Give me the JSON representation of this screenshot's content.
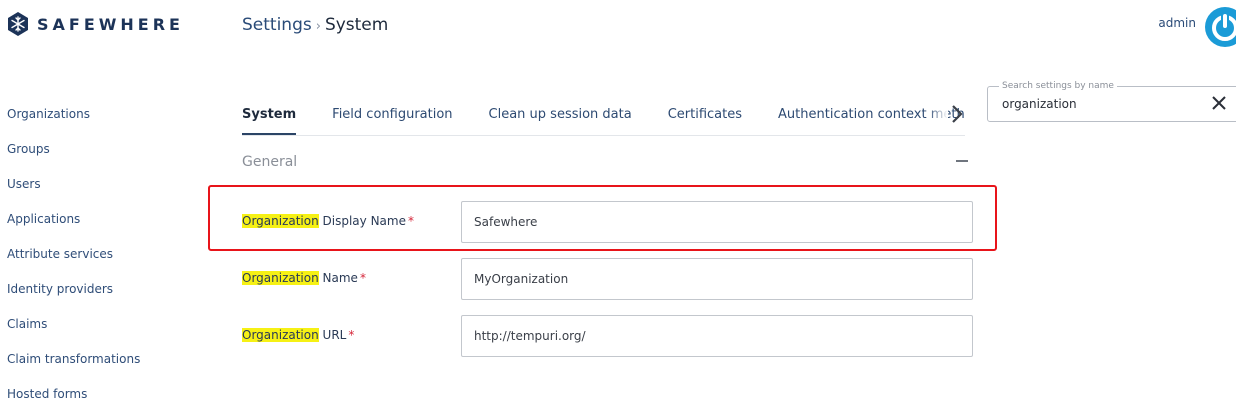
{
  "app": {
    "logo_text": "SAFEWHERE"
  },
  "header": {
    "breadcrumb_root": "Settings",
    "breadcrumb_sep": "›",
    "breadcrumb_current": "System",
    "user_name": "admin"
  },
  "sidebar": {
    "items": [
      {
        "label": "Organizations"
      },
      {
        "label": "Groups"
      },
      {
        "label": "Users"
      },
      {
        "label": "Applications"
      },
      {
        "label": "Attribute services"
      },
      {
        "label": "Identity providers"
      },
      {
        "label": "Claims"
      },
      {
        "label": "Claim transformations"
      },
      {
        "label": "Hosted forms"
      }
    ]
  },
  "tabs": [
    {
      "label": "System",
      "active": true
    },
    {
      "label": "Field configuration"
    },
    {
      "label": "Clean up session data"
    },
    {
      "label": "Certificates"
    },
    {
      "label": "Authentication context methods"
    }
  ],
  "search": {
    "label": "Search settings by name",
    "value": "organization"
  },
  "section": {
    "title": "General"
  },
  "fields": [
    {
      "highlight": "Organization",
      "label": " Display Name",
      "required": "*",
      "value": "Safewhere"
    },
    {
      "highlight": "Organization",
      "label": " Name",
      "required": "*",
      "value": "MyOrganization"
    },
    {
      "highlight": "Organization",
      "label": " URL",
      "required": "*",
      "value": "http://tempuri.org/"
    }
  ],
  "colors": {
    "brand": "#1c3358",
    "link": "#2f4d78",
    "search_highlight": "#f6f115",
    "required": "#d6263a",
    "annotation_box": "#e8141a",
    "avatar_accent": "#1b9bd7"
  }
}
